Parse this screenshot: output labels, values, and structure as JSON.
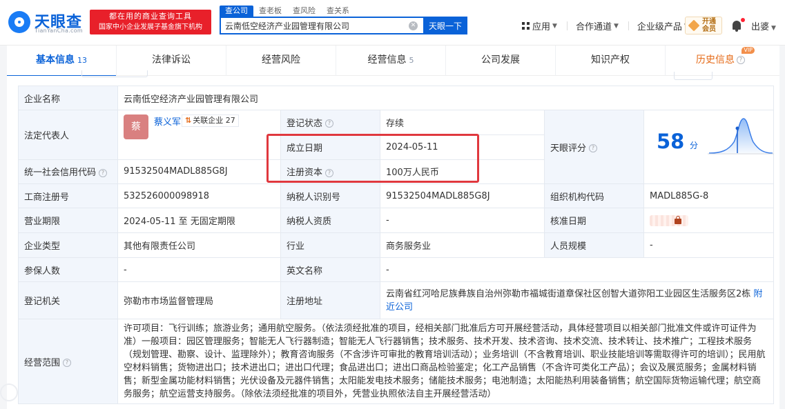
{
  "header": {
    "logo_cn": "天眼查",
    "logo_en": "TianYanCha.com",
    "slogan_line1": "都在用的商业查询工具",
    "slogan_line2": "国家中小企业发展子基金旗下机构",
    "search_tabs": [
      "查公司",
      "查老板",
      "查风险",
      "查关系"
    ],
    "search_value": "云南低空经济产业园管理有限公司",
    "search_button": "天眼一下",
    "nav": [
      "应用",
      "合作通道",
      "企业级产品"
    ],
    "vip_line1": "开通",
    "vip_line2": "会员",
    "user": "出婆"
  },
  "tabs": [
    {
      "label": "基本信息",
      "count": "13"
    },
    {
      "label": "法律诉讼",
      "count": ""
    },
    {
      "label": "经营风险",
      "count": ""
    },
    {
      "label": "经营信息",
      "count": "5"
    },
    {
      "label": "公司发展",
      "count": ""
    },
    {
      "label": "知识产权",
      "count": ""
    },
    {
      "label": "历史信息",
      "count": "",
      "badge": "VIP"
    }
  ],
  "info": {
    "company_name_label": "企业名称",
    "company_name": "云南低空经济产业园管理有限公司",
    "legal_rep_label": "法定代表人",
    "legal_rep_avatar": "蔡",
    "legal_rep_name": "蔡义军",
    "legal_rep_badge": "关联企业 27",
    "reg_status_label": "登记状态",
    "reg_status": "存续",
    "score_label": "天眼评分",
    "score": "58",
    "score_unit": "分",
    "found_date_label": "成立日期",
    "found_date": "2024-05-11",
    "reg_capital_label": "注册资本",
    "reg_capital": "100万人民币",
    "credit_code_label": "统一社会信用代码",
    "credit_code": "91532504MADL885G8J",
    "paid_capital_label": "实缴资本",
    "paid_capital": "-",
    "biz_reg_no_label": "工商注册号",
    "biz_reg_no": "532526000098918",
    "taxpayer_id_label": "纳税人识别号",
    "taxpayer_id": "91532504MADL885G8J",
    "org_code_label": "组织机构代码",
    "org_code": "MADL885G-8",
    "term_label": "营业期限",
    "term": "2024-05-11 至 无固定期限",
    "taxpayer_qual_label": "纳税人资质",
    "taxpayer_qual": "-",
    "approve_date_label": "核准日期",
    "type_label": "企业类型",
    "type": "其他有限责任公司",
    "industry_label": "行业",
    "industry": "商务服务业",
    "staff_label": "人员规模",
    "staff": "-",
    "insured_label": "参保人数",
    "insured": "-",
    "en_name_label": "英文名称",
    "en_name": "-",
    "authority_label": "登记机关",
    "authority": "弥勒市市场监督管理局",
    "address_label": "注册地址",
    "address": "云南省红河哈尼族彝族自治州弥勒市福城街道章保社区创智大道弥阳工业园区生活服务区2栋",
    "nearby_link": "附近公司",
    "scope_label": "经营范围",
    "scope": "许可项目：飞行训练；旅游业务；通用航空服务。（依法须经批准的项目，经相关部门批准后方可开展经营活动，具体经营项目以相关部门批准文件或许可证件为准）一般项目：园区管理服务；智能无人飞行器制造；智能无人飞行器销售；技术服务、技术开发、技术咨询、技术交流、技术转让、技术推广；工程技术服务（规划管理、勘察、设计、监理除外）；教育咨询服务（不含涉许可审批的教育培训活动）；业务培训（不含教育培训、职业技能培训等需取得许可的培训）；民用航空材料销售；货物进出口；技术进出口；进出口代理；食品进出口；进出口商品检验鉴定；化工产品销售（不含许可类化工产品）；会议及展览服务；金属材料销售；新型金属功能材料销售；光伏设备及元器件销售；太阳能发电技术服务；储能技术服务；电池制造；太阳能热利用装备销售；航空国际货物运输代理；航空商务服务；航空运营支持服务。（除依法须经批准的项目外，凭营业执照依法自主开展经营活动）"
  },
  "colors": {
    "brand": "#0a62d8",
    "status_green": "#1aa563",
    "highlight_red": "#e0383e"
  }
}
